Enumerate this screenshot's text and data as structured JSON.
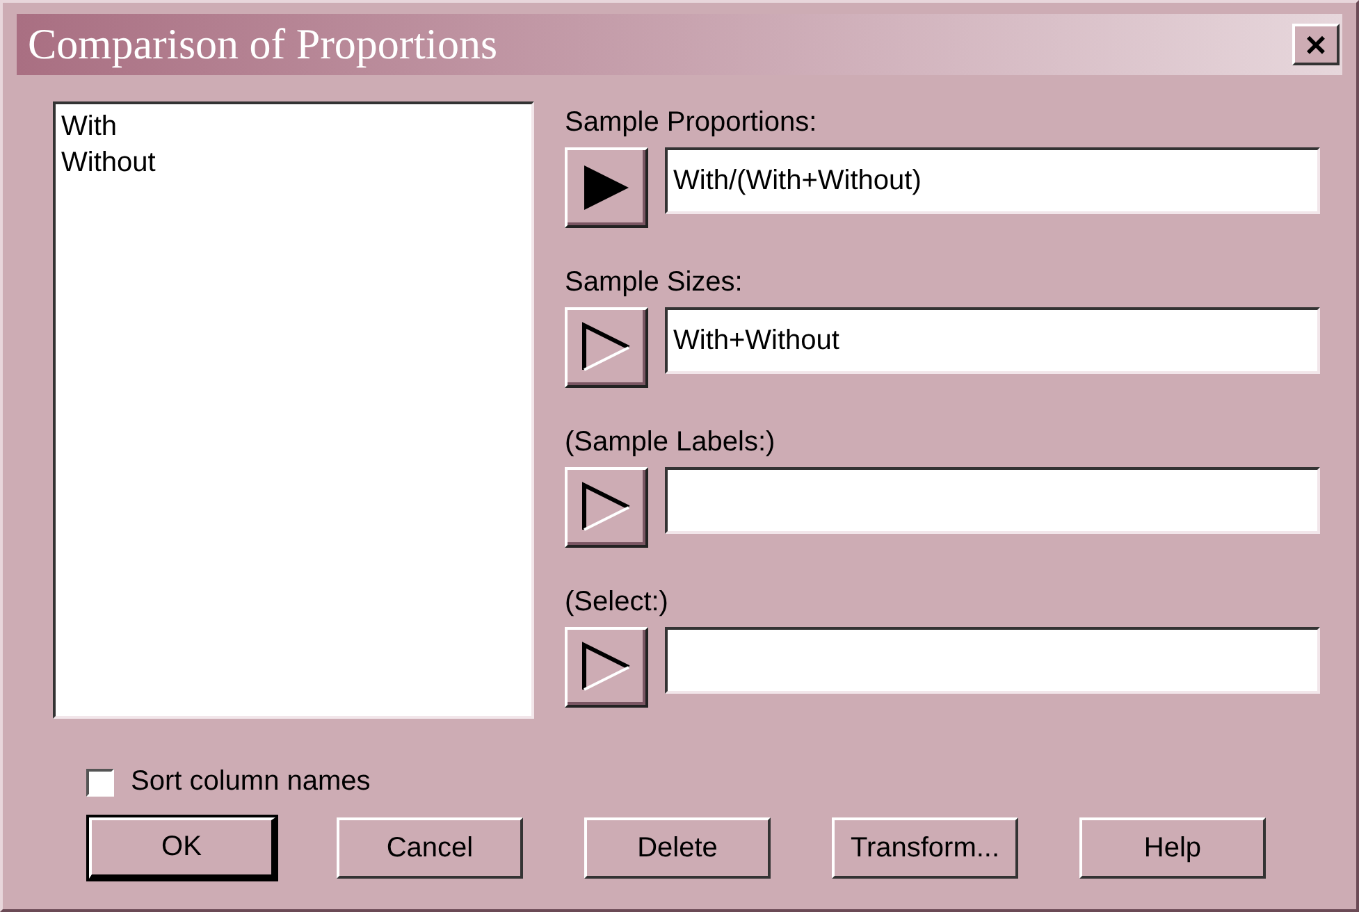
{
  "window": {
    "title": "Comparison of Proportions",
    "close": "×"
  },
  "columns_list": {
    "items": [
      {
        "label": "With",
        "selected": false
      },
      {
        "label": "Without",
        "selected": false
      }
    ]
  },
  "fields": [
    {
      "label": "Sample Proportions:",
      "value": "With/(With+Without)",
      "selected": true
    },
    {
      "label": "Sample Sizes:",
      "value": "With+Without",
      "selected": false
    },
    {
      "label": "(Sample Labels:)",
      "selected": false
    },
    {
      "label": "(Select:)",
      "selected": false
    }
  ],
  "sort_option": {
    "label": "Sort column names",
    "checked": false
  },
  "buttons": [
    {
      "label": "OK",
      "default": true
    },
    {
      "label": "Cancel",
      "default": false
    },
    {
      "label": "Delete",
      "default": false
    },
    {
      "label": "Transform...",
      "default": false
    },
    {
      "label": "Help",
      "default": false
    }
  ]
}
